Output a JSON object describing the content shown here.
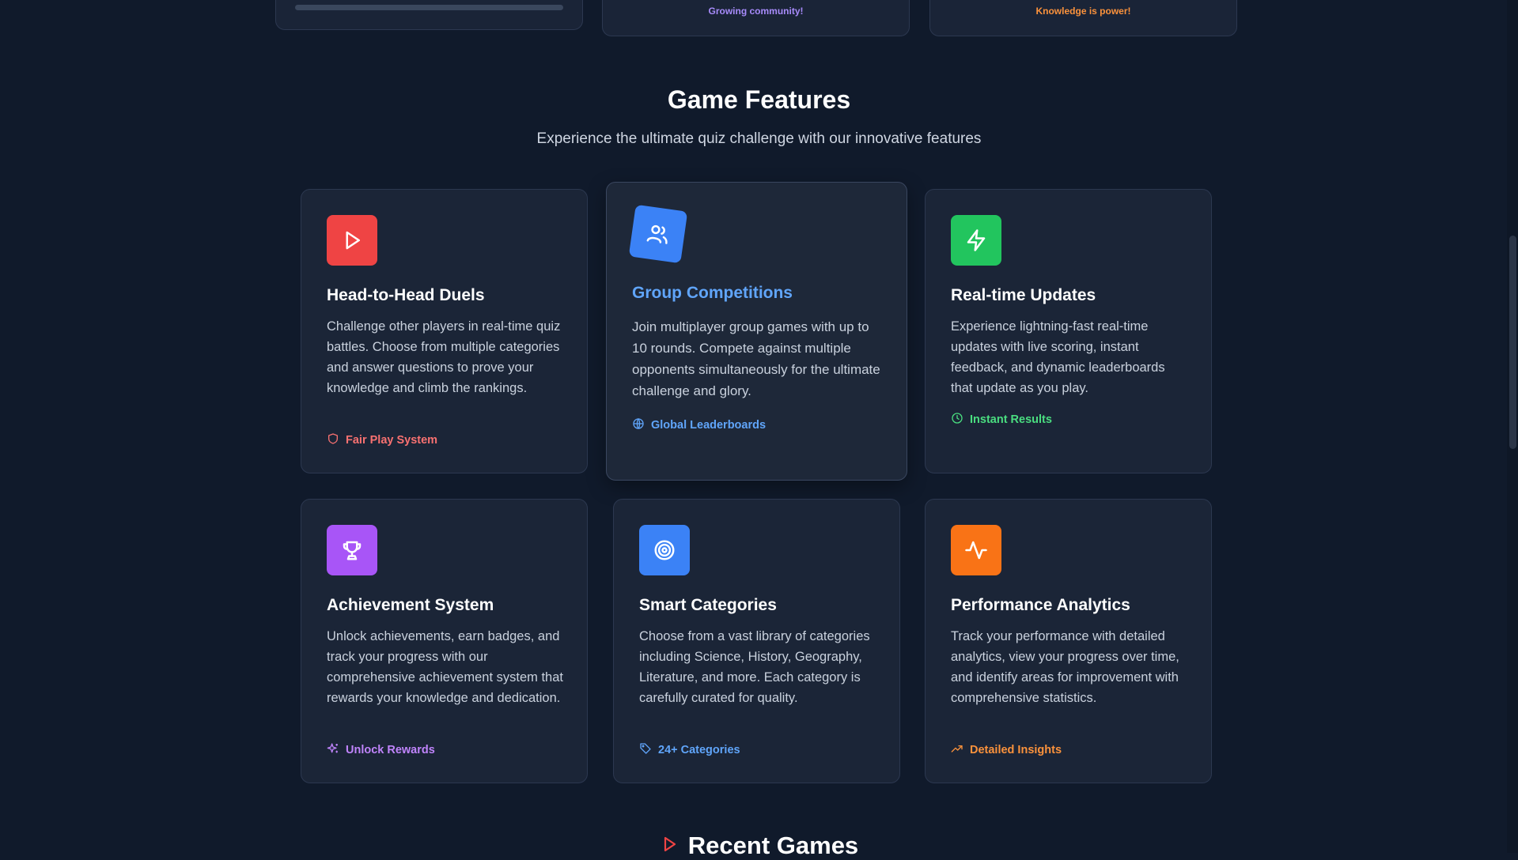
{
  "stats": {
    "community_caption": "Growing community!",
    "knowledge_caption": "Knowledge is power!"
  },
  "features": {
    "title": "Game Features",
    "subtitle": "Experience the ultimate quiz challenge with our innovative features",
    "cards": [
      {
        "title": "Head-to-Head Duels",
        "description": "Challenge other players in real-time quiz battles. Choose from multiple categories and answer questions to prove your knowledge and climb the rankings.",
        "tag": "Fair Play System",
        "icon": "play-icon",
        "tag_icon": "shield-icon",
        "color": "#ef4444",
        "tag_color": "#f87171"
      },
      {
        "title": "Group Competitions",
        "description": "Join multiplayer group games with up to 10 rounds. Compete against multiple opponents simultaneously for the ultimate challenge and glory.",
        "tag": "Global Leaderboards",
        "icon": "users-icon",
        "tag_icon": "globe-icon",
        "color": "#3b82f6",
        "tag_color": "#60a5fa"
      },
      {
        "title": "Real-time Updates",
        "description": "Experience lightning-fast real-time updates with live scoring, instant feedback, and dynamic leaderboards that update as you play.",
        "tag": "Instant Results",
        "icon": "lightning-icon",
        "tag_icon": "clock-icon",
        "color": "#22c55e",
        "tag_color": "#4ade80"
      },
      {
        "title": "Achievement System",
        "description": "Unlock achievements, earn badges, and track your progress with our comprehensive achievement system that rewards your knowledge and dedication.",
        "tag": "Unlock Rewards",
        "icon": "trophy-icon",
        "tag_icon": "sparkles-icon",
        "color": "#a855f7",
        "tag_color": "#c084fc"
      },
      {
        "title": "Smart Categories",
        "description": "Choose from a vast library of categories including Science, History, Geography, Literature, and more. Each category is carefully curated for quality.",
        "tag": "24+ Categories",
        "icon": "target-icon",
        "tag_icon": "tag-icon",
        "color": "#3b82f6",
        "tag_color": "#60a5fa"
      },
      {
        "title": "Performance Analytics",
        "description": "Track your performance with detailed analytics, view your progress over time, and identify areas for improvement with comprehensive statistics.",
        "tag": "Detailed Insights",
        "icon": "activity-icon",
        "tag_icon": "trending-up-icon",
        "color": "#f97316",
        "tag_color": "#fb923c"
      }
    ]
  },
  "recent": {
    "title": "Recent Games",
    "icon": "play-icon",
    "color": "#ef4444"
  }
}
